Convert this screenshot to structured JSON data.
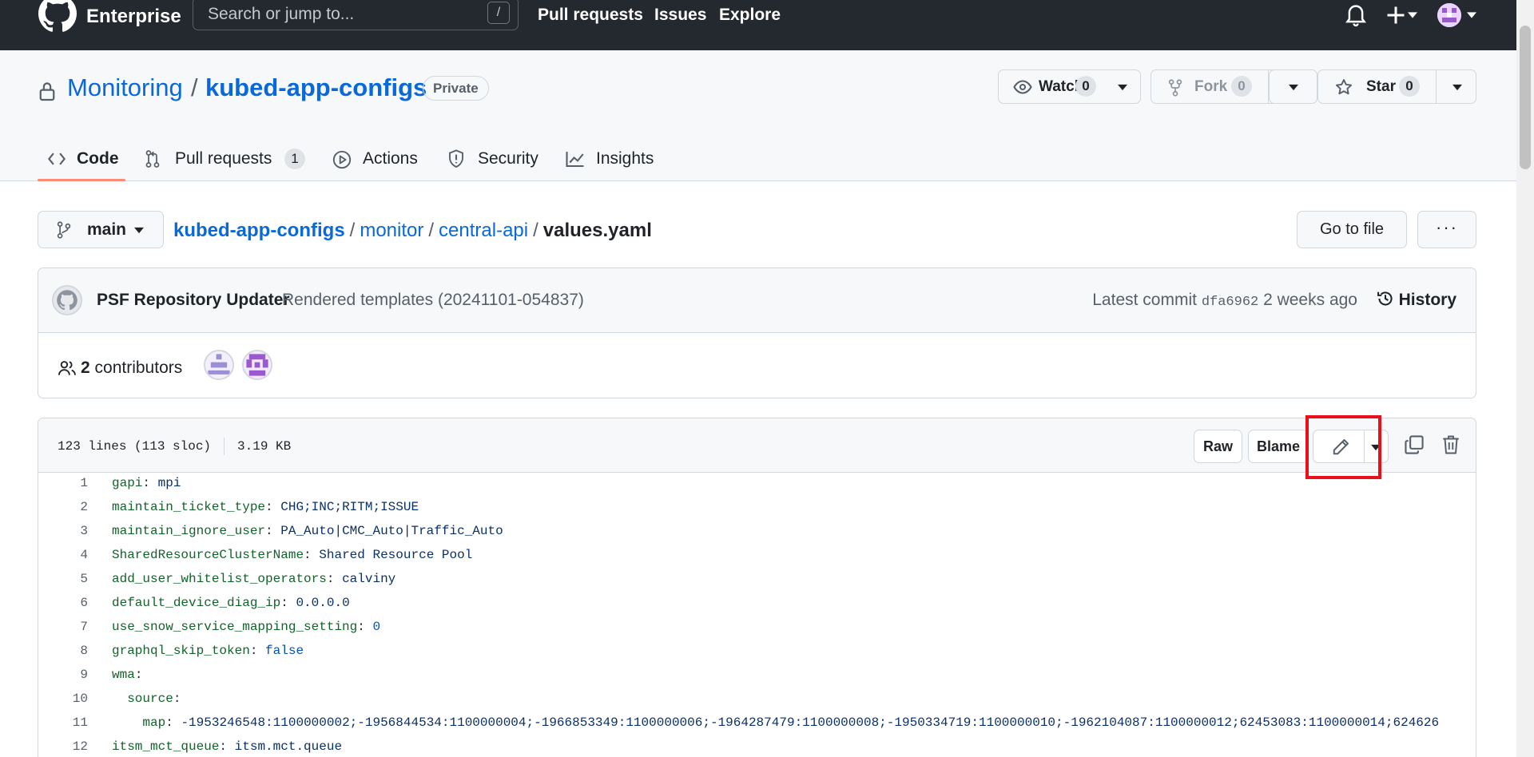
{
  "header": {
    "brand": "Enterprise",
    "search_placeholder": "Search or jump to...",
    "search_shortcut": "/",
    "nav": [
      "Pull requests",
      "Issues",
      "Explore"
    ]
  },
  "repo": {
    "owner": "Monitoring",
    "separator": "/",
    "name": "kubed-app-configs",
    "visibility": "Private",
    "watch": {
      "label": "Watch",
      "count": "0"
    },
    "fork": {
      "label": "Fork",
      "count": "0"
    },
    "star": {
      "label": "Star",
      "count": "0"
    },
    "tabs": [
      {
        "label": "Code",
        "icon": "code-icon",
        "active": true
      },
      {
        "label": "Pull requests",
        "icon": "git-pull-request-icon",
        "count": "1"
      },
      {
        "label": "Actions",
        "icon": "play-icon"
      },
      {
        "label": "Security",
        "icon": "shield-icon"
      },
      {
        "label": "Insights",
        "icon": "graph-icon"
      }
    ]
  },
  "file_nav": {
    "branch": "main",
    "breadcrumb": [
      "kubed-app-configs",
      "monitor",
      "central-api"
    ],
    "file_name": "values.yaml",
    "goto_label": "Go to file",
    "more_label": "···"
  },
  "commit": {
    "author": "PSF Repository Updater",
    "message": "Rendered templates (20241101-054837)",
    "latest_label": "Latest commit",
    "sha": "dfa6962",
    "age": "2 weeks ago",
    "history_label": "History",
    "contributors_count": "2",
    "contributors_label": "contributors"
  },
  "file": {
    "lines_info": "123 lines (113 sloc)",
    "size": "3.19 KB",
    "raw_label": "Raw",
    "blame_label": "Blame",
    "lines": [
      {
        "n": "1",
        "key": "gapi",
        "value": "mpi",
        "type": "string"
      },
      {
        "n": "2",
        "key": "maintain_ticket_type",
        "value": "CHG;INC;RITM;ISSUE",
        "type": "string"
      },
      {
        "n": "3",
        "key": "maintain_ignore_user",
        "value": "PA_Auto|CMC_Auto|Traffic_Auto",
        "type": "string"
      },
      {
        "n": "4",
        "key": "SharedResourceClusterName",
        "value": "Shared Resource Pool",
        "type": "string"
      },
      {
        "n": "5",
        "key": "add_user_whitelist_operators",
        "value": "calviny",
        "type": "string"
      },
      {
        "n": "6",
        "key": "default_device_diag_ip",
        "value": "0.0.0.0",
        "type": "string"
      },
      {
        "n": "7",
        "key": "use_snow_service_mapping_setting",
        "value": "0",
        "type": "number"
      },
      {
        "n": "8",
        "key": "graphql_skip_token",
        "value": "false",
        "type": "number"
      },
      {
        "n": "9",
        "key": "wma",
        "value": "",
        "type": "string"
      },
      {
        "n": "10",
        "key": "  source",
        "value": "",
        "type": "string"
      },
      {
        "n": "11",
        "key": "    map",
        "value": "-1953246548:1100000002;-1956844534:1100000004;-1966853349:1100000006;-1964287479:1100000008;-1950334719:1100000010;-1962104087:1100000012;62453083:1100000014;624626",
        "type": "string"
      },
      {
        "n": "12",
        "key": "itsm_mct_queue",
        "value": "itsm.mct.queue",
        "type": "string"
      }
    ]
  }
}
